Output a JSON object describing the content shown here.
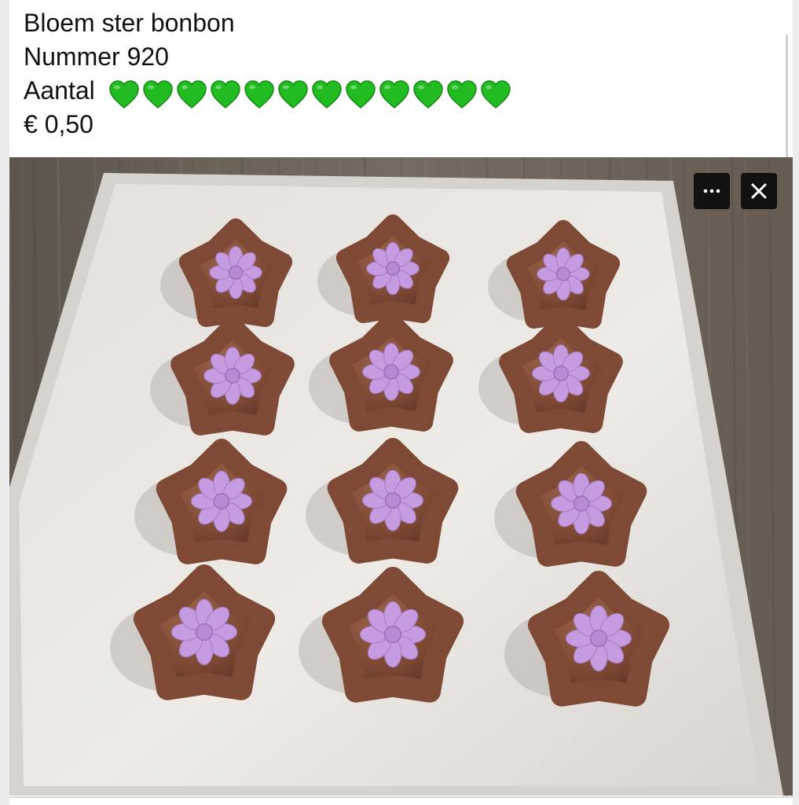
{
  "post": {
    "title": "Bloem ster bonbon",
    "number_line": "Nummer 920",
    "quantity_label": "Aantal",
    "quantity_hearts": 12,
    "heart_icon": "green-heart-emoji",
    "price": "€ 0,50"
  },
  "photo": {
    "subject": "",
    "rows": 4,
    "cols": 3,
    "colors": {
      "table": "#6f655b",
      "plate": "#eeebe8",
      "chocolate": "#7e4a35",
      "flower": "#c79be0"
    }
  },
  "viewer_controls": {
    "more_icon": "more-horizontal-icon",
    "close_icon": "close-icon"
  }
}
